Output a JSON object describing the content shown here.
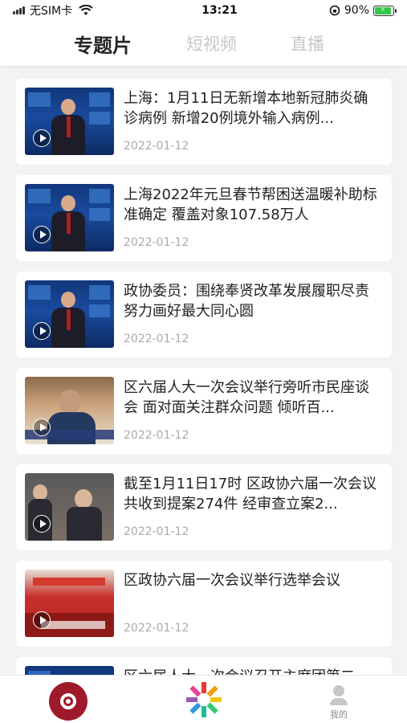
{
  "status_bar": {
    "carrier": "无SIM卡",
    "time": "13:21",
    "battery": "90%"
  },
  "tabs": [
    {
      "label": "专题片",
      "active": true
    },
    {
      "label": "短视频",
      "active": false
    },
    {
      "label": "直播",
      "active": false
    }
  ],
  "videos": [
    {
      "title": "上海：1月11日无新增本地新冠肺炎确诊病例 新增20例境外输入病例...",
      "date": "2022-01-12",
      "thumb": "news-anchor"
    },
    {
      "title": "上海2022年元旦春节帮困送温暖补助标准确定 覆盖对象107.58万人",
      "date": "2022-01-12",
      "thumb": "news-anchor"
    },
    {
      "title": "政协委员：围绕奉贤改革发展履职尽责 努力画好最大同心圆",
      "date": "2022-01-12",
      "thumb": "news-anchor"
    },
    {
      "title": "区六届人大一次会议举行旁听市民座谈会 面对面关注群众问题 倾听百...",
      "date": "2022-01-12",
      "thumb": "meeting"
    },
    {
      "title": "截至1月11日17时 区政协六届一次会议共收到提案274件 经审查立案2...",
      "date": "2022-01-12",
      "thumb": "delegates"
    },
    {
      "title": "区政协六届一次会议举行选举会议",
      "date": "2022-01-12",
      "thumb": "hall"
    },
    {
      "title": "区六届人大一次会议召开主席团第二",
      "date": "",
      "thumb": "news-anchor"
    }
  ],
  "bottom_nav": {
    "home_icon": "record-disc-icon",
    "center_icon": "star-logo-icon",
    "me_label": "我的"
  },
  "colors": {
    "brand_red": "#9e1a2a",
    "battery_green": "#33c64b"
  }
}
